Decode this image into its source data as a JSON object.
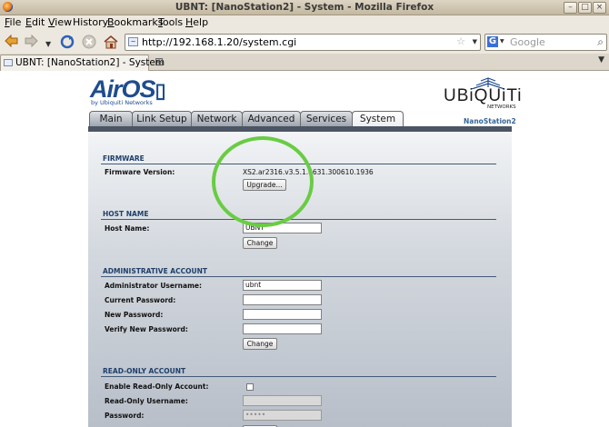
{
  "window": {
    "title": "UBNT: [NanoStation2] - System - Mozilla Firefox"
  },
  "menu": [
    {
      "label": "File",
      "u": "F",
      "rest": "ile"
    },
    {
      "label": "Edit",
      "u": "E",
      "rest": "dit"
    },
    {
      "label": "View",
      "u": "V",
      "rest": "iew"
    },
    {
      "label": "History",
      "u": "",
      "rest": "History"
    },
    {
      "label": "Bookmarks",
      "u": "B",
      "rest": "ookmarks"
    },
    {
      "label": "Tools",
      "u": "T",
      "rest": "ools"
    },
    {
      "label": "Help",
      "u": "H",
      "rest": "elp"
    }
  ],
  "nav": {
    "url": "http://192.168.1.20/system.cgi",
    "search_placeholder": "Google"
  },
  "browser_tab": {
    "label": "UBNT: [NanoStation2] - System"
  },
  "brand": {
    "logo": "AirOS",
    "logo_sub": "by Ubiquiti Networks",
    "vendor": "UBiQUiTi",
    "vendor_sub": "NETWORKS",
    "device": "NanoStation2"
  },
  "tabs": [
    "Main",
    "Link Setup",
    "Network",
    "Advanced",
    "Services",
    "System"
  ],
  "active_tab": "System",
  "firmware": {
    "title": "FIRMWARE",
    "version_label": "Firmware Version:",
    "version_value": "XS2.ar2316.v3.5.1.4631.300610.1936",
    "upgrade_button": "Upgrade..."
  },
  "hostname": {
    "title": "HOST NAME",
    "label": "Host Name:",
    "value": "UBNT",
    "button": "Change"
  },
  "admin": {
    "title": "ADMINISTRATIVE ACCOUNT",
    "username_label": "Administrator Username:",
    "username_value": "ubnt",
    "current_password_label": "Current Password:",
    "new_password_label": "New Password:",
    "verify_password_label": "Verify New Password:",
    "button": "Change"
  },
  "readonly": {
    "title": "READ-ONLY ACCOUNT",
    "enable_label": "Enable Read-Only Account:",
    "username_label": "Read-Only Username:",
    "password_label": "Password:",
    "password_mask": "•••••"
  },
  "colors": {
    "highlight_ring": "#69cc43",
    "section_title": "#1f3f6a",
    "brand_blue": "#1f4c8f"
  }
}
